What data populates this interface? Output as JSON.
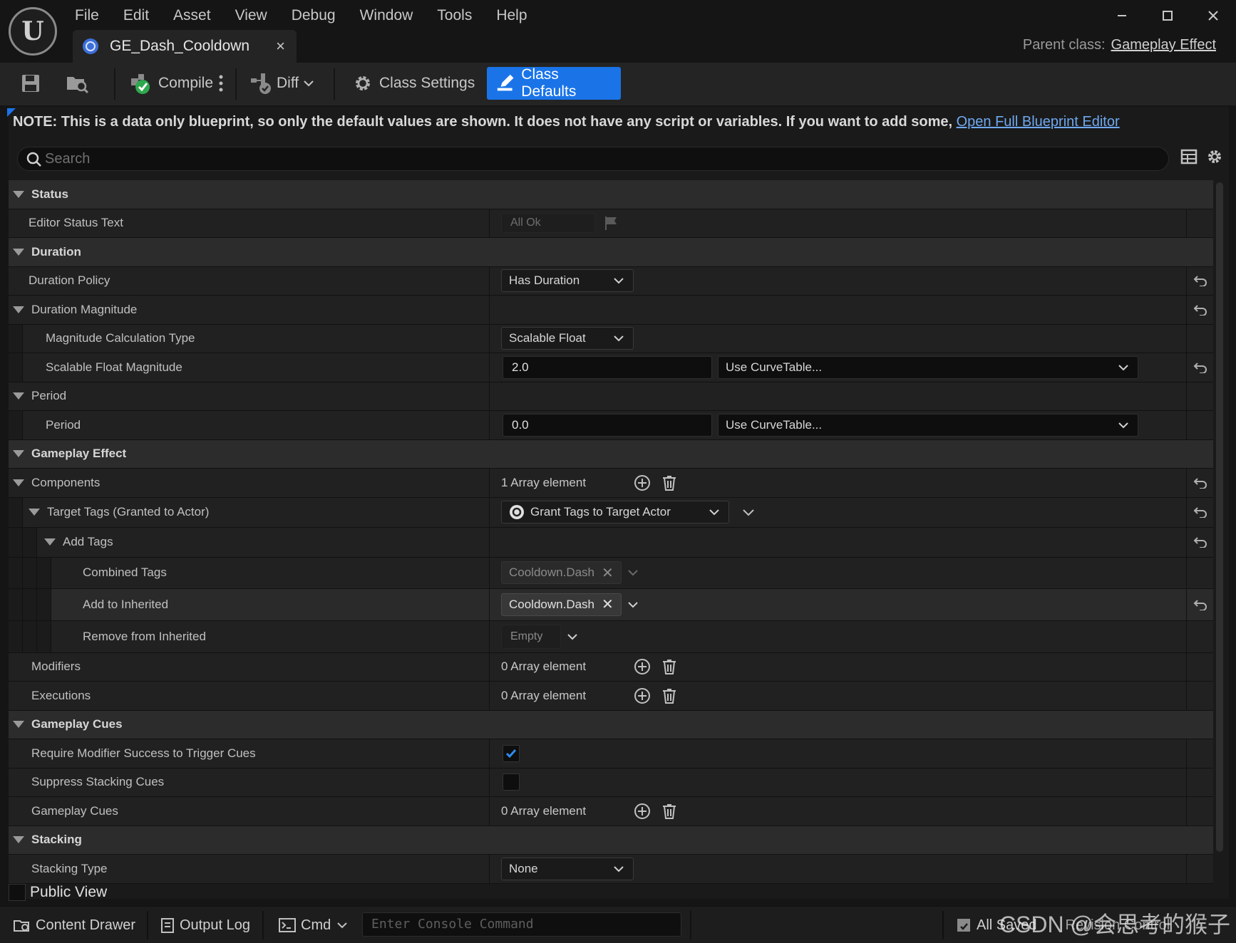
{
  "menu": [
    "File",
    "Edit",
    "Asset",
    "View",
    "Debug",
    "Window",
    "Tools",
    "Help"
  ],
  "tab": {
    "title": "GE_Dash_Cooldown",
    "close": "×"
  },
  "parent_class": {
    "label": "Parent class:",
    "value": "Gameplay Effect"
  },
  "toolbar": {
    "compile": "Compile",
    "diff": "Diff",
    "class_settings": "Class Settings",
    "class_defaults": "Class Defaults"
  },
  "note": {
    "text": "NOTE: This is a data only blueprint, so only the default values are shown.  It does not have any script or variables.  If you want to add some,",
    "link": "Open Full Blueprint Editor"
  },
  "search": {
    "placeholder": "Search"
  },
  "details": {
    "status": {
      "header": "Status",
      "editor_status_text": "Editor Status Text",
      "editor_status_value": "All Ok"
    },
    "duration": {
      "header": "Duration",
      "duration_policy": "Duration Policy",
      "duration_policy_value": "Has Duration",
      "duration_magnitude": "Duration Magnitude",
      "magnitude_calc_type": "Magnitude Calculation Type",
      "magnitude_calc_type_value": "Scalable Float",
      "scalable_float_magnitude": "Scalable Float Magnitude",
      "scalable_float_value": "2.0",
      "curve_table": "Use CurveTable...",
      "period_group": "Period",
      "period": "Period",
      "period_value": "0.0",
      "period_curve_table": "Use CurveTable..."
    },
    "gameplay_effect": {
      "header": "Gameplay Effect",
      "components": "Components",
      "components_value": "1 Array element",
      "target_tags": "Target Tags (Granted to Actor)",
      "target_tags_value": "Grant Tags to Target Actor",
      "add_tags": "Add Tags",
      "combined_tags": "Combined Tags",
      "combined_tags_value": "Cooldown.Dash",
      "add_to_inherited": "Add to Inherited",
      "add_to_inherited_value": "Cooldown.Dash",
      "remove_from_inherited": "Remove from Inherited",
      "remove_from_inherited_value": "Empty",
      "modifiers": "Modifiers",
      "modifiers_value": "0 Array element",
      "executions": "Executions",
      "executions_value": "0 Array element"
    },
    "gameplay_cues": {
      "header": "Gameplay Cues",
      "require_modifier_success": "Require Modifier Success to Trigger Cues",
      "require_modifier_success_checked": true,
      "suppress_stacking_cues": "Suppress Stacking Cues",
      "suppress_stacking_cues_checked": false,
      "gameplay_cues": "Gameplay Cues",
      "gameplay_cues_value": "0 Array element"
    },
    "stacking": {
      "header": "Stacking",
      "stacking_type": "Stacking Type",
      "stacking_type_value": "None"
    }
  },
  "public_view": "Public View",
  "statusbar": {
    "content_drawer": "Content Drawer",
    "output_log": "Output Log",
    "cmd": "Cmd",
    "console_placeholder": "Enter Console Command",
    "all_saved": "All Saved",
    "revision_control": "Revision Control"
  },
  "watermark": "CSDN @会思考的猴子",
  "colors": {
    "accent": "#1a74e8",
    "link": "#6fa8f0",
    "background": "#151515"
  }
}
